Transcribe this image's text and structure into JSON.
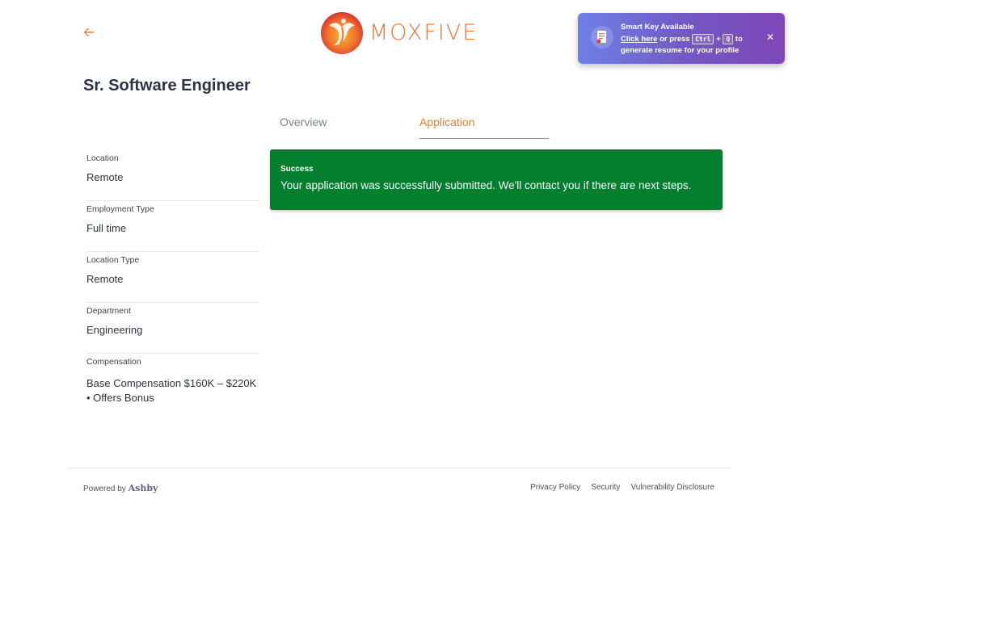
{
  "header": {
    "back_icon": "arrow-left-icon",
    "logo_text": "MOXFIVE",
    "logo_icon": "phoenix-logo-icon"
  },
  "smart_key": {
    "title": "Smart Key Available",
    "link_text": "Click here",
    "press_text": "or press",
    "key_1": "Ctrl",
    "plus": "+",
    "key_2": "Q",
    "to_text": "to",
    "line3": "generate resume for your profile",
    "close": "✕"
  },
  "job": {
    "title": "Sr. Software Engineer"
  },
  "tabs": [
    {
      "label": "Overview",
      "active": false
    },
    {
      "label": "Application",
      "active": true
    }
  ],
  "sidebar": {
    "items": [
      {
        "label": "Location",
        "value": "Remote"
      },
      {
        "label": "Employment Type",
        "value": "Full time"
      },
      {
        "label": "Location Type",
        "value": "Remote"
      },
      {
        "label": "Department",
        "value": "Engineering"
      },
      {
        "label": "Compensation",
        "value": "Base Compensation $160K – $220K • Offers Bonus"
      }
    ]
  },
  "banner": {
    "title": "Success",
    "message": "Your application was successfully submitted. We'll contact you if there are next steps."
  },
  "footer": {
    "powered_by": "Powered by",
    "brand": "Ashby",
    "links": [
      "Privacy Policy",
      "Security",
      "Vulnerability Disclosure"
    ]
  },
  "colors": {
    "accent": "#e8812e",
    "success": "#017e2e"
  }
}
